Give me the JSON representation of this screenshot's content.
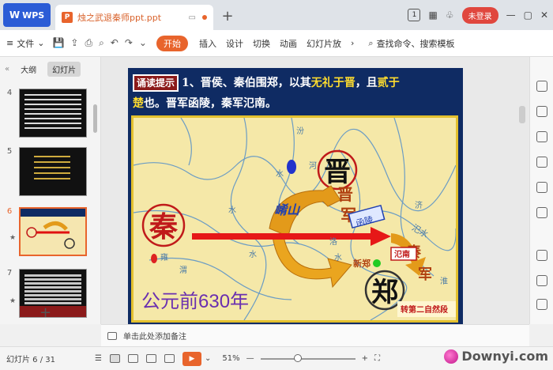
{
  "titlebar": {
    "app_tab": "WPS",
    "doc_tab": "烛之武退秦师ppt.ppt",
    "badge_count": "1",
    "login": "未登录"
  },
  "menu": {
    "file": "文件",
    "start": "开始",
    "items": [
      "插入",
      "设计",
      "切换",
      "动画",
      "幻灯片放"
    ],
    "search": "查找命令、搜索模板"
  },
  "left_panel": {
    "tab_outline": "大纲",
    "tab_slides": "幻灯片",
    "slide_numbers": [
      "4",
      "5",
      "6",
      "7"
    ],
    "star": "★"
  },
  "slide": {
    "recite_tag": "诵读提示",
    "text_1": "1、晋侯、秦伯围郑，以其",
    "highlight_1": "无礼于晋",
    "text_2": "，且",
    "highlight_2": "贰于",
    "highlight_3": "楚",
    "text_3": "也。晋军函陵，秦军氾南。",
    "map": {
      "qin": "秦",
      "jin": "晋",
      "zheng": "郑",
      "jin_army_1": "晋",
      "jin_army_2": "军",
      "qin_army_1": "秦",
      "qin_army_2": "军",
      "xiaoshan": "崤山",
      "hanling": "函陵",
      "fannan": "氾南",
      "fanshui": "氾水",
      "xinzheng": "新郑",
      "yong": "雍",
      "water_labels": [
        "水",
        "水",
        "水",
        "汾",
        "河",
        "渭",
        "水",
        "淮",
        "洛",
        "济"
      ],
      "year": "公元前630年",
      "footer": "转第二自然段"
    }
  },
  "notes": {
    "placeholder": "单击此处添加备注"
  },
  "status": {
    "slide_counter": "幻灯片 6 / 31",
    "zoom": "51%",
    "watermark": "Downyi.com"
  }
}
